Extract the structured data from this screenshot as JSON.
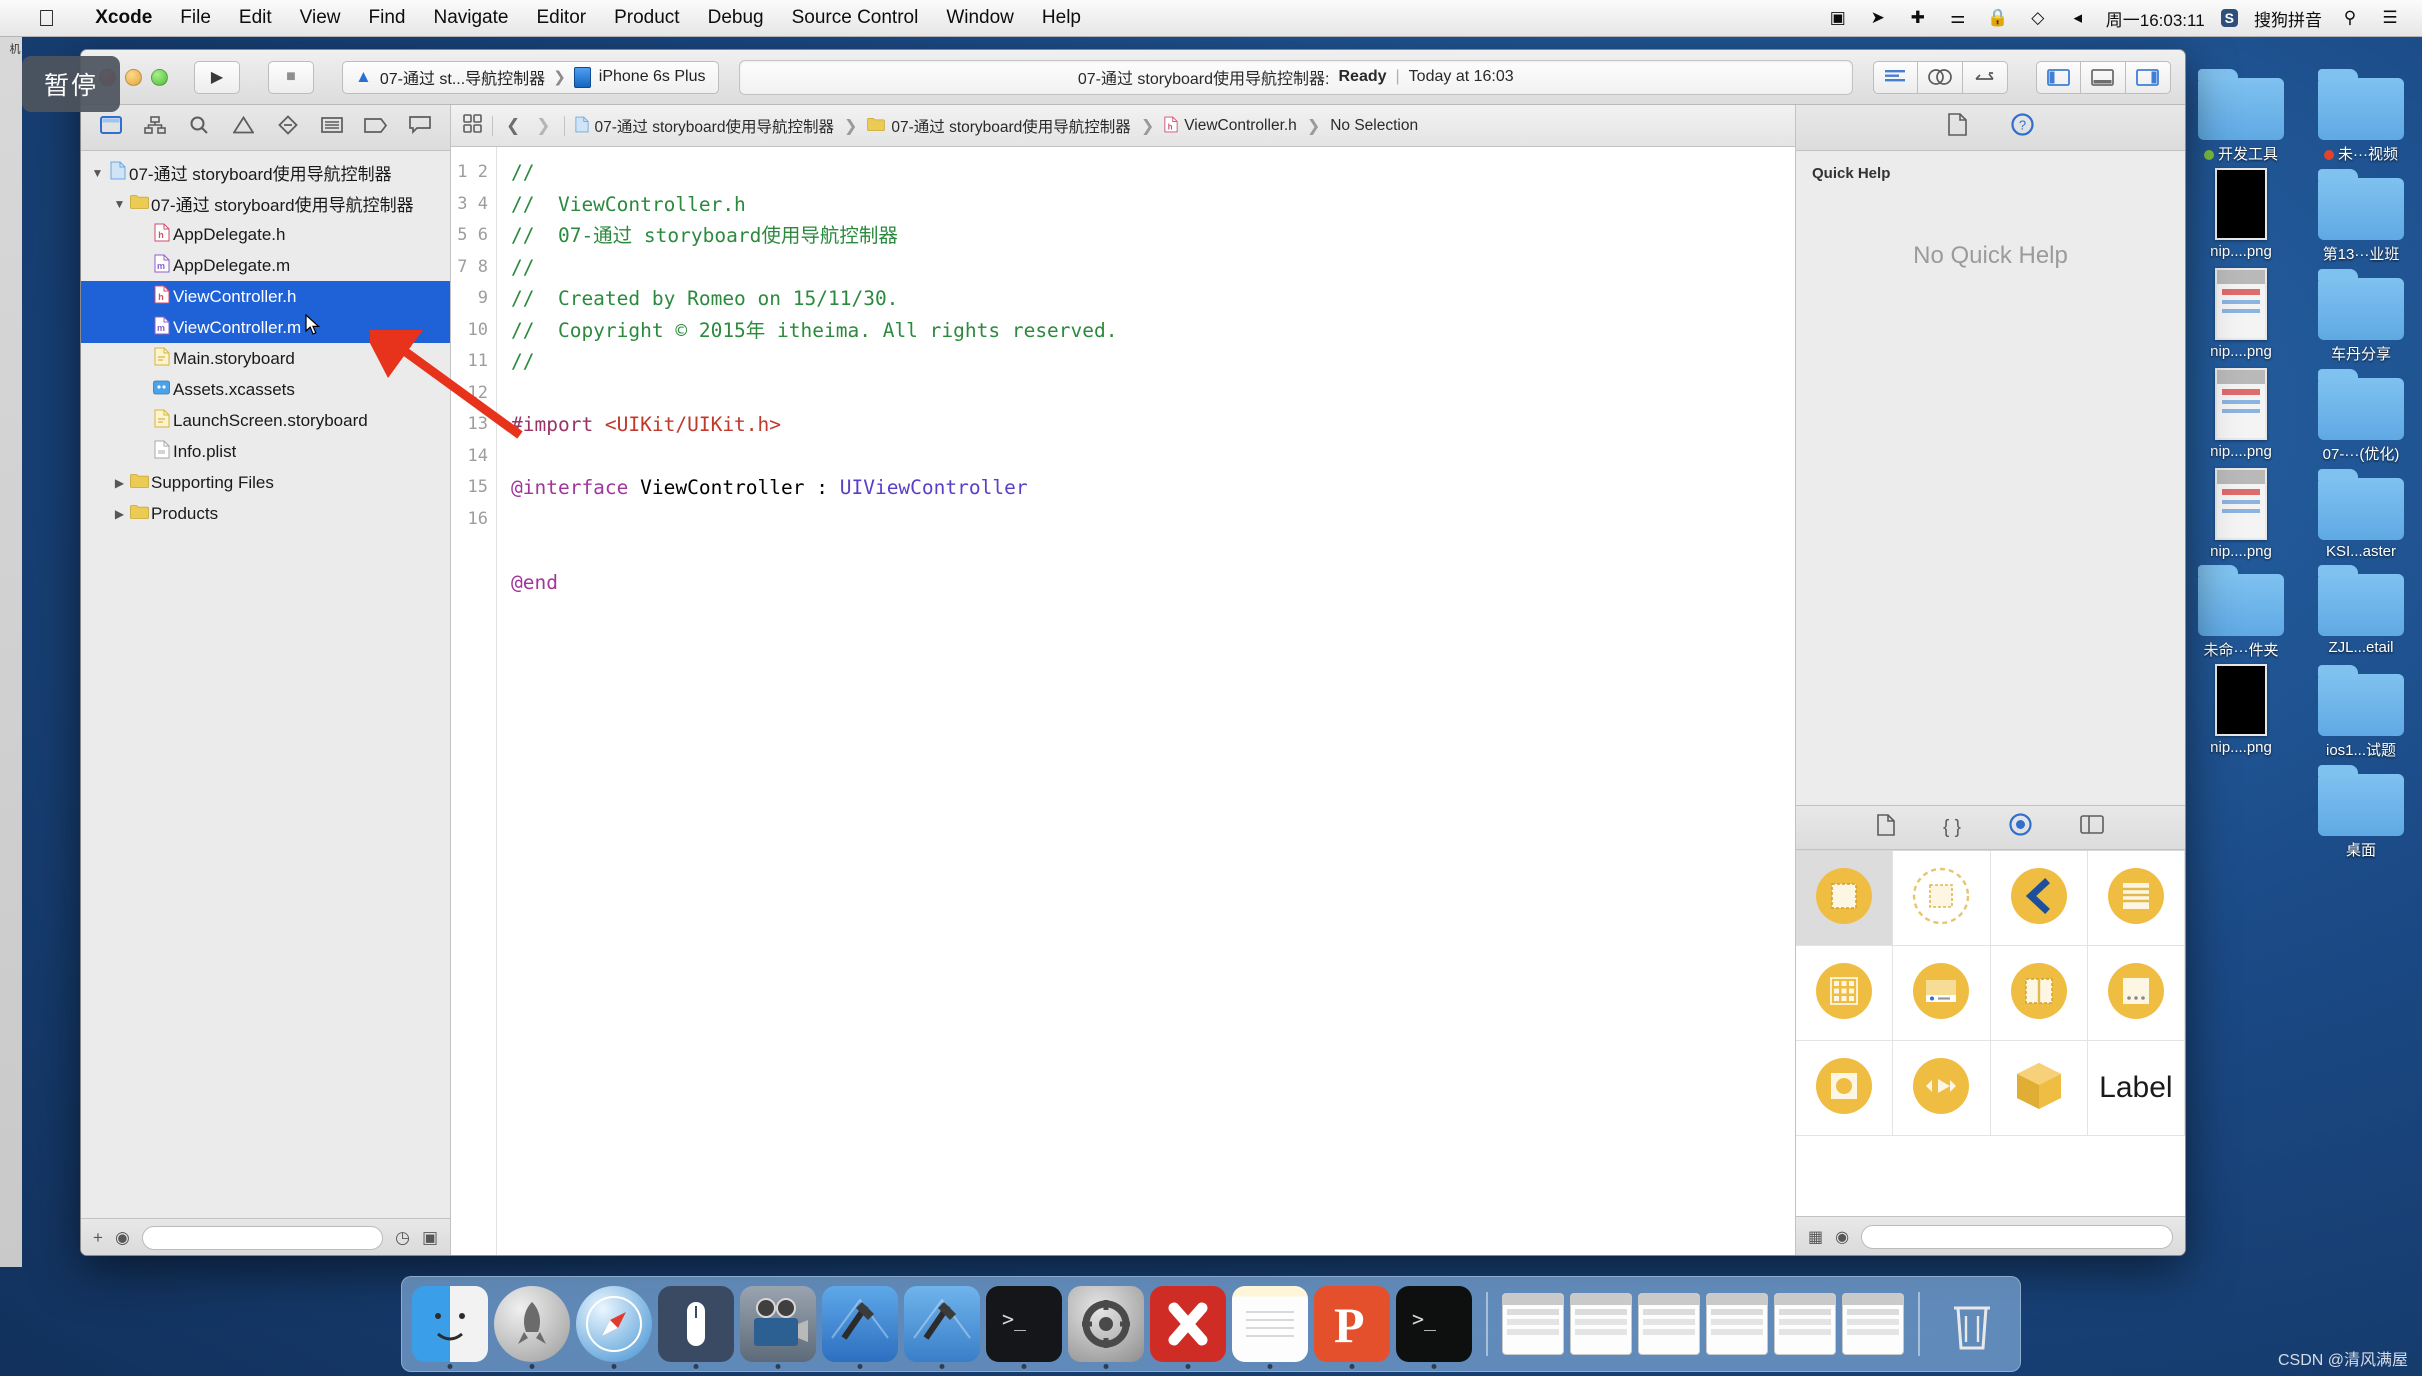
{
  "menubar": {
    "apple_icon": "apple-icon",
    "items": [
      "Xcode",
      "File",
      "Edit",
      "View",
      "Find",
      "Navigate",
      "Editor",
      "Product",
      "Debug",
      "Source Control",
      "Window",
      "Help"
    ],
    "status_icons": [
      "screen-record-icon",
      "location-icon",
      "bluetooth-icon",
      "airdrop-icon",
      "lock-icon",
      "vpn-icon",
      "volume-icon"
    ],
    "clock": "周一16:03:11",
    "input_method_badge": "S",
    "input_method": "搜狗拼音",
    "search_icon": "search-icon",
    "notification_icon": "notification-center-icon"
  },
  "tooltip": {
    "text": "暂停"
  },
  "toolbar": {
    "run_icon": "run-triangle-icon",
    "stop_icon": "stop-square-icon",
    "scheme_name": "07-通过 st...导航控制器",
    "destination": "iPhone 6s Plus",
    "status_project": "07-通过 storyboard使用导航控制器:",
    "status_state": "Ready",
    "status_divider": "|",
    "status_time": "Today at 16:03",
    "editor_buttons": [
      "standard-editor-icon",
      "assistant-editor-icon",
      "version-editor-icon"
    ],
    "view_buttons": [
      "navigator-toggle-icon",
      "debug-toggle-icon",
      "utilities-toggle-icon"
    ]
  },
  "navigator": {
    "tabs": [
      "project-navigator-icon",
      "symbol-navigator-icon",
      "find-navigator-icon",
      "issue-navigator-icon",
      "test-navigator-icon",
      "debug-navigator-icon",
      "breakpoint-navigator-icon",
      "report-navigator-icon"
    ],
    "selected_tab_index": 0,
    "tree": [
      {
        "label": "07-通过 storyboard使用导航控制器",
        "indent": 0,
        "twisty": "▼",
        "icon": "project-icon",
        "icon_class": "ic-proj",
        "selected": false
      },
      {
        "label": "07-通过 storyboard使用导航控制器",
        "indent": 1,
        "twisty": "▼",
        "icon": "folder-icon",
        "icon_class": "ic-folder",
        "selected": false
      },
      {
        "label": "AppDelegate.h",
        "indent": 2,
        "twisty": "",
        "icon": "header-file-icon",
        "icon_class": "ic-h",
        "selected": false
      },
      {
        "label": "AppDelegate.m",
        "indent": 2,
        "twisty": "",
        "icon": "implementation-file-icon",
        "icon_class": "ic-m",
        "selected": false
      },
      {
        "label": "ViewController.h",
        "indent": 2,
        "twisty": "",
        "icon": "header-file-icon",
        "icon_class": "ic-h",
        "selected": true
      },
      {
        "label": "ViewController.m",
        "indent": 2,
        "twisty": "",
        "icon": "implementation-file-icon",
        "icon_class": "ic-m",
        "selected": true
      },
      {
        "label": "Main.storyboard",
        "indent": 2,
        "twisty": "",
        "icon": "storyboard-file-icon",
        "icon_class": "ic-sb",
        "selected": false
      },
      {
        "label": "Assets.xcassets",
        "indent": 2,
        "twisty": "",
        "icon": "assets-catalog-icon",
        "icon_class": "ic-xc",
        "selected": false
      },
      {
        "label": "LaunchScreen.storyboard",
        "indent": 2,
        "twisty": "",
        "icon": "storyboard-file-icon",
        "icon_class": "ic-sb",
        "selected": false
      },
      {
        "label": "Info.plist",
        "indent": 2,
        "twisty": "",
        "icon": "plist-file-icon",
        "icon_class": "ic-plist",
        "selected": false
      },
      {
        "label": "Supporting Files",
        "indent": 1,
        "twisty": "▶",
        "icon": "folder-icon",
        "icon_class": "ic-folder",
        "selected": false
      },
      {
        "label": "Products",
        "indent": 1,
        "twisty": "▶",
        "icon": "folder-icon",
        "icon_class": "ic-folder",
        "selected": false
      }
    ],
    "footer": {
      "add_icon": "plus-icon",
      "filter_icon": "filter-icon",
      "recent_icon": "clock-icon",
      "unsaved_icon": "unsaved-icon"
    }
  },
  "jumpbar": {
    "related_icon": "related-files-icon",
    "back_icon": "chevron-left-icon",
    "forward_icon": "chevron-right-icon",
    "crumbs": [
      {
        "label": "07-通过 storyboard使用导航控制器",
        "icon": "project-icon",
        "icon_class": "ic-proj"
      },
      {
        "label": "07-通过 storyboard使用导航控制器",
        "icon": "folder-icon",
        "icon_class": "ic-folder"
      },
      {
        "label": "ViewController.h",
        "icon": "header-file-icon",
        "icon_class": "ic-h"
      },
      {
        "label": "No Selection",
        "icon": "",
        "icon_class": ""
      }
    ]
  },
  "editor": {
    "line_count": 16,
    "lines": [
      [
        {
          "t": "//",
          "c": "cm"
        }
      ],
      [
        {
          "t": "//  ViewController.h",
          "c": "cm"
        }
      ],
      [
        {
          "t": "//  07-通过 storyboard使用导航控制器",
          "c": "cm"
        }
      ],
      [
        {
          "t": "//",
          "c": "cm"
        }
      ],
      [
        {
          "t": "//  Created by Romeo on 15/11/30.",
          "c": "cm"
        }
      ],
      [
        {
          "t": "//  Copyright © 2015年 itheima. All rights reserved.",
          "c": "cm"
        }
      ],
      [
        {
          "t": "//",
          "c": "cm"
        }
      ],
      [
        {
          "t": "",
          "c": ""
        }
      ],
      [
        {
          "t": "#import ",
          "c": "pp"
        },
        {
          "t": "<UIKit/UIKit.h>",
          "c": "str"
        }
      ],
      [
        {
          "t": "",
          "c": ""
        }
      ],
      [
        {
          "t": "@interface",
          "c": "kw"
        },
        {
          "t": " ViewController : ",
          "c": ""
        },
        {
          "t": "UIViewController",
          "c": "ty"
        }
      ],
      [
        {
          "t": "",
          "c": ""
        }
      ],
      [
        {
          "t": "",
          "c": ""
        }
      ],
      [
        {
          "t": "@end",
          "c": "kw"
        }
      ],
      [
        {
          "t": "",
          "c": ""
        }
      ],
      [
        {
          "t": "",
          "c": ""
        }
      ]
    ]
  },
  "utilities": {
    "inspector_tabs": [
      "file-inspector-icon",
      "quick-help-inspector-icon"
    ],
    "selected_inspector": 1,
    "quick_help_title": "Quick Help",
    "quick_help_empty": "No Quick Help",
    "library_tabs": [
      "file-template-library-icon",
      "code-snippet-library-icon",
      "object-library-icon",
      "media-library-icon"
    ],
    "selected_library": 2,
    "objects": [
      {
        "name": "view-object",
        "icon": "view-icon",
        "selected": true
      },
      {
        "name": "view-controller-object",
        "icon": "view-controller-icon",
        "selected": false
      },
      {
        "name": "navigation-controller-object",
        "icon": "navigation-controller-icon",
        "selected": false
      },
      {
        "name": "table-view-controller-object",
        "icon": "table-view-controller-icon",
        "selected": false
      },
      {
        "name": "collection-view-controller-object",
        "icon": "collection-view-controller-icon",
        "selected": false
      },
      {
        "name": "tab-bar-controller-object",
        "icon": "tab-bar-controller-icon",
        "selected": false
      },
      {
        "name": "split-view-controller-object",
        "icon": "split-view-controller-icon",
        "selected": false
      },
      {
        "name": "page-view-controller-object",
        "icon": "page-view-controller-icon",
        "selected": false
      },
      {
        "name": "glkit-view-controller-object",
        "icon": "glkit-view-controller-icon",
        "selected": false
      },
      {
        "name": "avkit-player-controller-object",
        "icon": "avkit-player-icon",
        "selected": false
      },
      {
        "name": "object-cube-object",
        "icon": "object-cube-icon",
        "selected": false
      },
      {
        "name": "label-object",
        "icon": "label-icon",
        "label": "Label",
        "selected": false
      }
    ],
    "filter_icons": [
      "grid-view-icon",
      "filter-icon"
    ]
  },
  "desktop": {
    "icons": [
      {
        "label": "开发工具",
        "type": "folder",
        "tag_color": "#7bbf3e"
      },
      {
        "label": "未···视频",
        "type": "folder",
        "tag_color": "#e0442e"
      },
      {
        "label": "nip....png",
        "type": "screenshot-black"
      },
      {
        "label": "第13···业班",
        "type": "folder"
      },
      {
        "label": "nip....png",
        "type": "screenshot-light"
      },
      {
        "label": "车丹分享",
        "type": "folder"
      },
      {
        "label": "nip....png",
        "type": "screenshot-light"
      },
      {
        "label": "07-···(优化)",
        "type": "folder"
      },
      {
        "label": "nip....png",
        "type": "screenshot-light"
      },
      {
        "label": "KSI...aster",
        "type": "folder"
      },
      {
        "label": "未命···件夹",
        "type": "folder"
      },
      {
        "label": "ZJL...etail",
        "type": "folder"
      },
      {
        "label": "nip....png",
        "type": "screenshot-black"
      },
      {
        "label": "ios1...试题",
        "type": "folder"
      },
      {
        "label": "",
        "type": "none"
      },
      {
        "label": "桌面",
        "type": "folder"
      }
    ]
  },
  "dock": {
    "apps": [
      {
        "name": "finder-icon"
      },
      {
        "name": "launchpad-icon"
      },
      {
        "name": "safari-icon"
      },
      {
        "name": "mouse-app-icon"
      },
      {
        "name": "quicktime-icon"
      },
      {
        "name": "xcode-icon"
      },
      {
        "name": "xcode-beta-icon"
      },
      {
        "name": "terminal-icon"
      },
      {
        "name": "system-preferences-icon"
      },
      {
        "name": "xmind-icon"
      },
      {
        "name": "notes-icon"
      },
      {
        "name": "papers-icon"
      },
      {
        "name": "iterm-icon"
      }
    ],
    "minimized": [
      {
        "name": "minimized-window-1"
      },
      {
        "name": "minimized-window-2"
      },
      {
        "name": "minimized-window-3"
      },
      {
        "name": "minimized-window-4"
      },
      {
        "name": "minimized-window-5"
      },
      {
        "name": "minimized-window-6"
      }
    ],
    "trash_icon": "trash-icon"
  },
  "watermark": {
    "text": "CSDN @清风满屋"
  },
  "sidebar_sliver": {
    "text": "机"
  }
}
